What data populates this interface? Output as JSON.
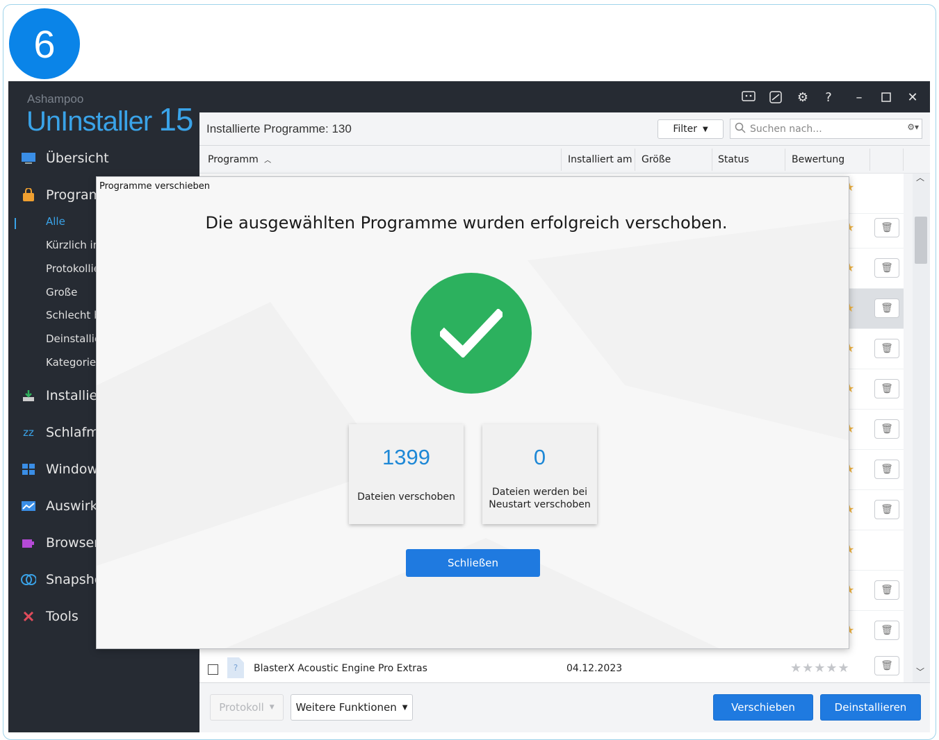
{
  "step_badge": "6",
  "brand": {
    "small": "Ashampoo",
    "name": "UnInstaller",
    "version": "15"
  },
  "sidebar": {
    "items": [
      {
        "label": "Übersicht",
        "icon": "monitor-icon"
      },
      {
        "label": "Programme",
        "icon": "package-icon"
      },
      {
        "label": "Installieren",
        "icon": "install-icon"
      },
      {
        "label": "Schlafmodus",
        "icon": "sleep-icon"
      },
      {
        "label": "Windows",
        "icon": "windows-icon"
      },
      {
        "label": "Auswirkungen",
        "icon": "chart-icon"
      },
      {
        "label": "Browser",
        "icon": "puzzle-icon"
      },
      {
        "label": "Snapshots",
        "icon": "snapshot-icon"
      },
      {
        "label": "Tools",
        "icon": "tools-icon"
      }
    ],
    "sub_items": [
      "Alle",
      "Kürzlich installiert",
      "Protokolliert",
      "Große",
      "Schlecht bewertet",
      "Deinstalliert",
      "Kategorien"
    ]
  },
  "toolbar": {
    "installed_label": "Installierte Programme: 130",
    "filter_label": "Filter",
    "search_placeholder": "Suchen nach..."
  },
  "table": {
    "columns": [
      "Programm",
      "Installiert am",
      "Größe",
      "Status",
      "Bewertung"
    ],
    "last_row": {
      "name": "BlasterX Acoustic Engine Pro Extras",
      "installed": "04.12.2023",
      "rating": "★★★★★"
    }
  },
  "footer": {
    "protokoll": "Protokoll",
    "weitere": "Weitere Funktionen",
    "verschieben": "Verschieben",
    "deinstallieren": "Deinstallieren"
  },
  "dialog": {
    "title": "Programme verschieben",
    "message": "Die ausgewählten Programme wurden erfolgreich verschoben.",
    "moved_count": "1399",
    "moved_label": "Dateien verschoben",
    "pending_count": "0",
    "pending_label": "Dateien werden bei Neustart verschoben",
    "close_label": "Schließen"
  },
  "colors": {
    "accent": "#1f7ae0",
    "brand": "#3aa3e8",
    "success": "#2cb15e",
    "sidebar_bg": "#262b33"
  }
}
